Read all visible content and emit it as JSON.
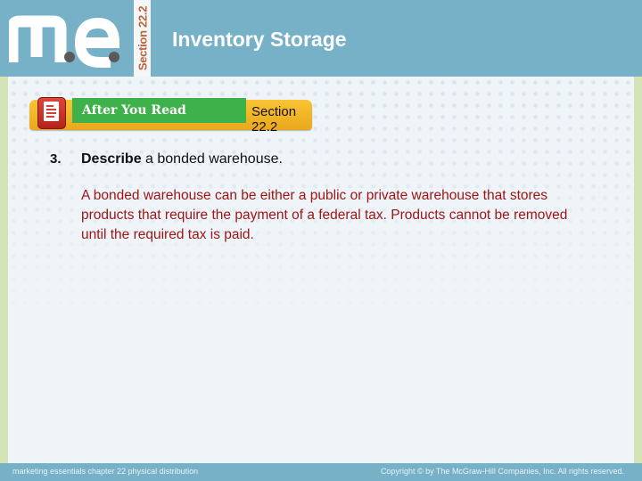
{
  "header": {
    "logo_text": "me",
    "section_tab": "Section 22.2",
    "title": "Inventory Storage"
  },
  "banner": {
    "icon": "document-icon",
    "label": "After You Read",
    "section": "Section 22.2"
  },
  "question": {
    "number": "3.",
    "keyword": "Describe",
    "rest": " a bonded warehouse."
  },
  "answer": {
    "text": "A bonded warehouse can be either a public or private warehouse that stores products that require the payment of a federal tax. Products cannot be removed until the required tax is paid."
  },
  "footer": {
    "left": "marketing essentials  chapter 22  physical distribution",
    "right": "Copyright © by The McGraw-Hill Companies, Inc. All rights reserved."
  },
  "colors": {
    "header_bg": "#77b1c8",
    "answer_text": "#9e1414",
    "banner_green": "#3fb14b",
    "banner_gold": "#f9c433",
    "side_strip": "#d3e4b6"
  }
}
